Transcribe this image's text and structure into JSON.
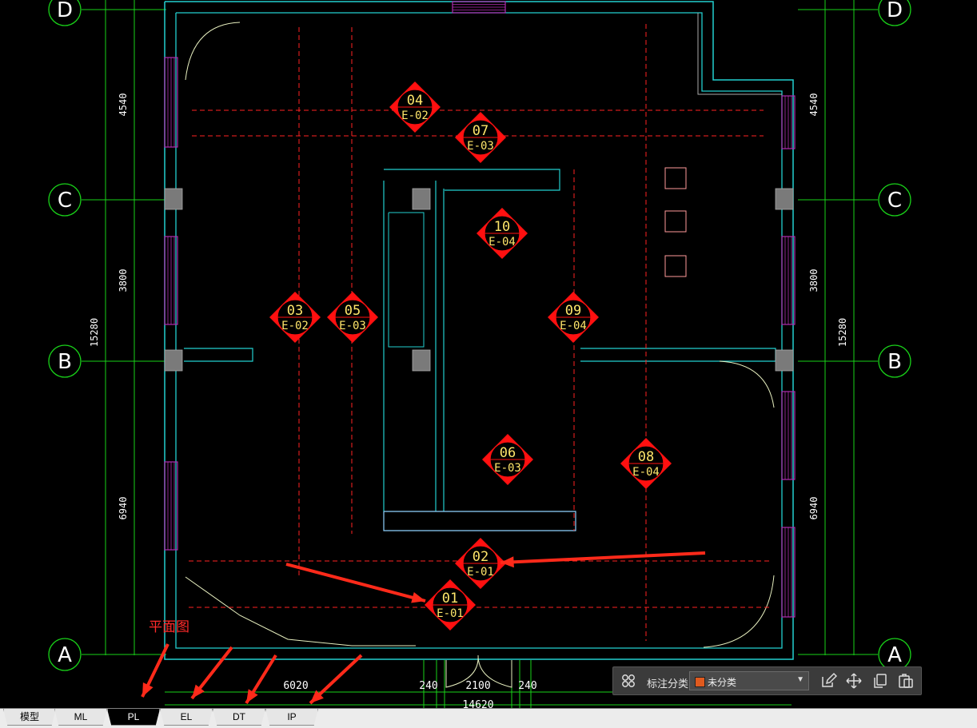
{
  "tabs": [
    {
      "label": "模型",
      "active": false
    },
    {
      "label": "ML",
      "active": false
    },
    {
      "label": "PL",
      "active": true
    },
    {
      "label": "EL",
      "active": false
    },
    {
      "label": "DT",
      "active": false
    },
    {
      "label": "IP",
      "active": false
    }
  ],
  "annotation_toolbar": {
    "label": "标注分类",
    "selected": "未分类",
    "swatch_color": "#e05a1e",
    "icons": [
      "grid-icon",
      "edit-icon",
      "move-icon",
      "copy-icon",
      "paste-icon"
    ]
  },
  "plan_label": "平面图",
  "grid_axes": [
    "D",
    "C",
    "B",
    "A"
  ],
  "dimensions": {
    "left": [
      "4540",
      "3800",
      "6940"
    ],
    "left_total": "15280",
    "right": [
      "4540",
      "3800",
      "6940"
    ],
    "right_total": "15280",
    "bottom": [
      "6020",
      "240",
      "2100",
      "240"
    ],
    "bottom_total": "14620"
  },
  "elevation_markers": [
    {
      "num": "01",
      "sheet": "E-01"
    },
    {
      "num": "02",
      "sheet": "E-01"
    },
    {
      "num": "03",
      "sheet": "E-02"
    },
    {
      "num": "04",
      "sheet": "E-02"
    },
    {
      "num": "05",
      "sheet": "E-03"
    },
    {
      "num": "06",
      "sheet": "E-03"
    },
    {
      "num": "07",
      "sheet": "E-03"
    },
    {
      "num": "08",
      "sheet": "E-04"
    },
    {
      "num": "09",
      "sheet": "E-04"
    },
    {
      "num": "10",
      "sheet": "E-04"
    }
  ],
  "colors": {
    "grid_line": "#19d219",
    "wall": "#22cfcf",
    "window": "#b02cb0",
    "dashed": "#ff2222",
    "marker": "#ff1010",
    "marker_text": "#ffe66b",
    "dimension": "#19d219"
  }
}
